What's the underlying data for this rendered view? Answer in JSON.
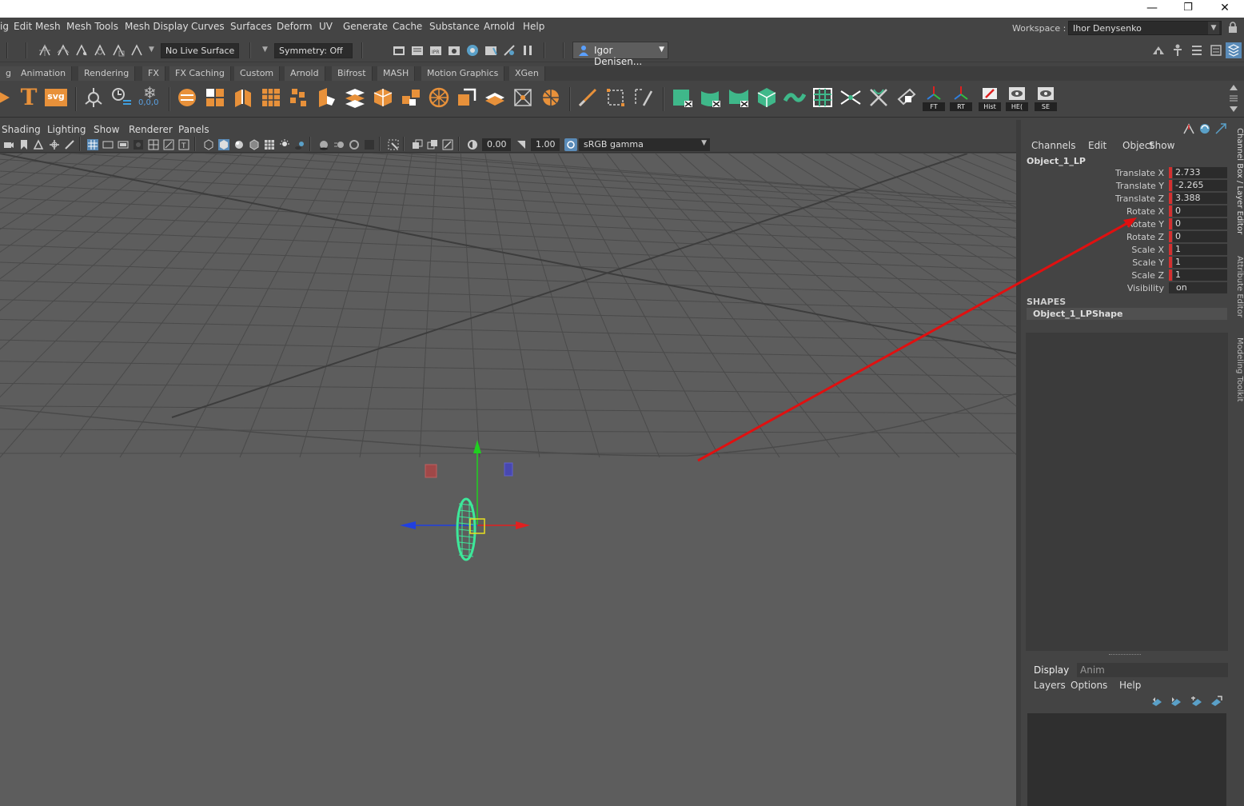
{
  "window": {
    "minimize_glyph": "—",
    "restore_glyph": "❐",
    "close_glyph": "✕"
  },
  "menubar": {
    "items": [
      "ig",
      "Edit Mesh",
      "Mesh Tools",
      "Mesh Display",
      "Curves",
      "Surfaces",
      "Deform",
      "UV",
      "Generate",
      "Cache",
      "Substance",
      "Arnold",
      "Help"
    ],
    "workspace_label": "Workspace :",
    "workspace_value": "Ihor Denysenko"
  },
  "statusline": {
    "live_surface": "No Live Surface",
    "symmetry": "Symmetry: Off",
    "user": "Igor Denisen..."
  },
  "shelf_tabs": [
    "g",
    "Animation",
    "Rendering",
    "FX",
    "FX Caching",
    "Custom",
    "Arnold",
    "Bifrost",
    "MASH",
    "Motion Graphics",
    "XGen"
  ],
  "shelf": {
    "svg_label": "svg",
    "text_label": "T",
    "snow_label": "0,0,0",
    "label_icons": [
      "FT",
      "RT",
      "Hist",
      "HE(",
      "SE"
    ]
  },
  "panel_menu": [
    "Shading",
    "Lighting",
    "Show",
    "Renderer",
    "Panels"
  ],
  "panel_bar": {
    "exposure": "0.00",
    "gamma": "1.00",
    "color_space": "sRGB gamma"
  },
  "channel_box": {
    "menus": [
      "Channels",
      "Edit",
      "Object",
      "Show"
    ],
    "object_name": "Object_1_LP",
    "attributes": [
      {
        "label": "Translate X",
        "value": "2.733"
      },
      {
        "label": "Translate Y",
        "value": "-2.265"
      },
      {
        "label": "Translate Z",
        "value": "3.388"
      },
      {
        "label": "Rotate X",
        "value": "0"
      },
      {
        "label": "Rotate Y",
        "value": "0"
      },
      {
        "label": "Rotate Z",
        "value": "0"
      },
      {
        "label": "Scale X",
        "value": "1"
      },
      {
        "label": "Scale Y",
        "value": "1"
      },
      {
        "label": "Scale Z",
        "value": "1"
      },
      {
        "label": "Visibility",
        "value": "on"
      }
    ],
    "shapes_title": "SHAPES",
    "shape_name": "Object_1_LPShape"
  },
  "layer_editor": {
    "tabs": [
      "Display",
      "Anim"
    ],
    "menus": [
      "Layers",
      "Options",
      "Help"
    ]
  },
  "side_tabs": [
    "Channel Box / Layer Editor",
    "Attribute Editor",
    "Modeling Toolkit"
  ],
  "colors": {
    "annotation_arrow": "#e01010",
    "mesh": "#3de89a",
    "x_axis": "#e02020",
    "y_axis": "#20d020",
    "z_axis": "#2040e0",
    "keyed_attr": "#d43030",
    "shelf_orange": "#e8913a",
    "shelf_green": "#3fb88a"
  }
}
